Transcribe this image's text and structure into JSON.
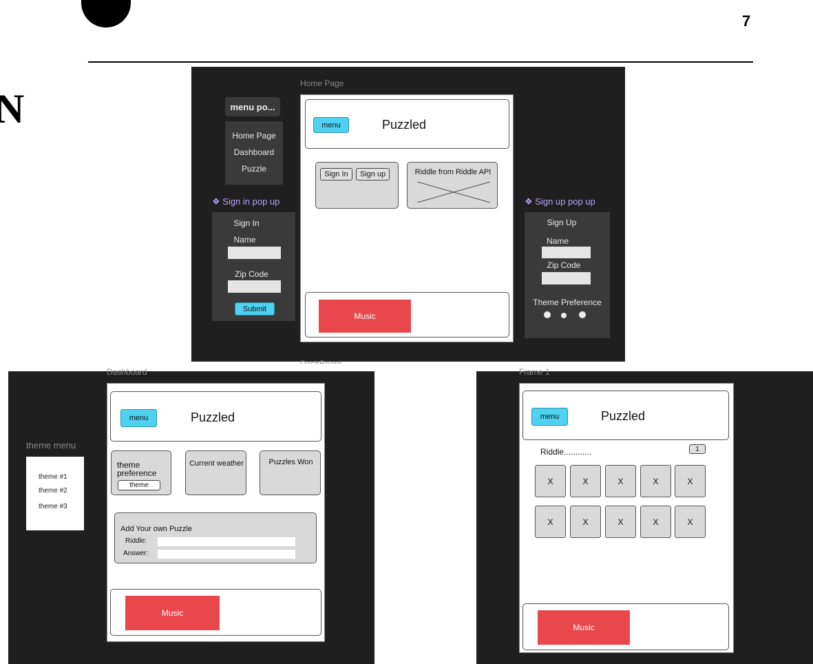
{
  "page": {
    "number": "7",
    "partial_letter": "N"
  },
  "home_frame": {
    "label": "Home Page",
    "menu_label": "menu",
    "app_title": "Puzzled",
    "sign_in_label": "Sign In",
    "sign_up_label": "Sign up",
    "riddle_card_title": "Riddle from Riddle API",
    "music_label": "Music",
    "below_label": "DashBoard"
  },
  "menu_popup": {
    "title": "menu po...",
    "items": [
      "Home Page",
      "Dashboard",
      "Puzzle"
    ]
  },
  "sign_in_popup": {
    "header": "Sign in pop up",
    "title": "Sign In",
    "name_label": "Name",
    "zip_label": "Zip Code",
    "submit_label": "Submit"
  },
  "sign_up_popup": {
    "header": "Sign up pop up",
    "title": "Sign Up",
    "name_label": "Name",
    "zip_label": "Zip Code",
    "theme_label": "Theme Preference"
  },
  "dashboard_frame": {
    "label": "Dashboard",
    "menu_label": "menu",
    "app_title": "Puzzled",
    "theme_pref_label": "theme preference",
    "theme_button": "theme",
    "weather_label": "Current weather",
    "won_label": "Puzzles Won",
    "add_puzzle_title": "Add Your own Puzzle",
    "riddle_label": "Riddle:",
    "answer_label": "Answer:",
    "music_label": "Music"
  },
  "theme_menu": {
    "title": "theme menu",
    "items": [
      "theme #1",
      "theme #2",
      "theme #3"
    ]
  },
  "puzzle_frame": {
    "label": "Frame 1",
    "menu_label": "menu",
    "app_title": "Puzzled",
    "riddle_text": "Riddle............",
    "counter": "1",
    "tiles_row1": [
      "X",
      "X",
      "X",
      "X",
      "X"
    ],
    "tiles_row2": [
      "X",
      "X",
      "X",
      "X",
      "X"
    ],
    "music_label": "Music"
  },
  "colors": {
    "accent_cyan": "#4fd1f0",
    "music_red": "#e8474c",
    "frame_dark": "#1f1f1f",
    "popup_header": "#b8a3ff"
  }
}
